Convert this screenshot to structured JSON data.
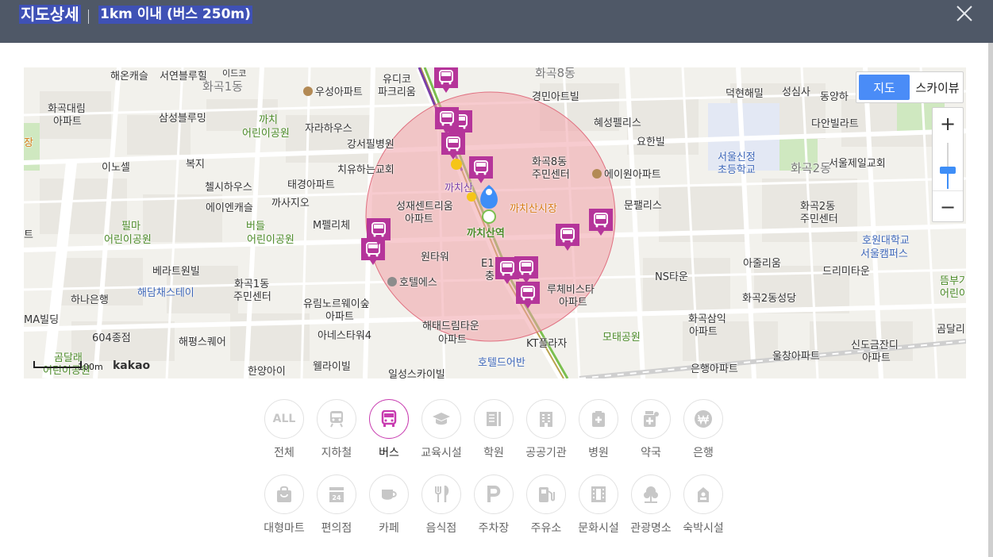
{
  "header": {
    "title": "지도상세",
    "subtitle": "1km 이내 (버스 250m)"
  },
  "map": {
    "maptype": {
      "map": "지도",
      "skyview": "스카이뷰"
    },
    "zoom": {
      "in": "+",
      "out": "−"
    },
    "scale_label": "100m",
    "provider": "kakao",
    "labels": {
      "l1": "해온캐슬",
      "l2": "서연블루힐",
      "l3": "화곡1동",
      "l4": "유디코",
      "l5": "화곡8동",
      "l6": "화곡대림",
      "l7": "아파트",
      "l8": "우성아파트",
      "l9": "파크리움",
      "l10": "경민아트빌",
      "l11": "덕현해밀",
      "l12": "성심사",
      "l13": "동양하",
      "l14": "삼성블루밍",
      "l15": "까치",
      "l16": "어린이공원",
      "l17": "자라하우스",
      "l18": "혜성펠리스",
      "l19": "다안빌라트",
      "l20": "강서필병원",
      "l21": "요한빌",
      "l22": "서울신정",
      "l23": "초등학교",
      "l24": "이노셀",
      "l25": "복지",
      "l26": "치유하는교회",
      "l27": "화곡8동",
      "l28": "주민센터",
      "l29": "에이원아파트",
      "l30": "서울제일교회",
      "l31": "화곡2동",
      "l32": "첼시하우스",
      "l33": "태경아파트",
      "l34": "까치산",
      "l35": "에이엔캐슬",
      "l36": "까사지오",
      "l37": "성재센트리움",
      "l38": "아파트",
      "l39": "까치산시장",
      "l40": "문팰리스",
      "l41": "화곡2동",
      "l42": "주민센터",
      "l43": "필마",
      "l44": "어린이공원",
      "l45": "버들",
      "l46": "어린이공원",
      "l47": "M펠리체",
      "l48": "까치산역",
      "l49": "호원대학교",
      "l50": "서울캠퍼스",
      "l51": "원타워",
      "l52": "E1",
      "l53": "아줄리움",
      "l54": "베라트원빌",
      "l55": "NS타운",
      "l56": "드리미타운",
      "l57": "화곡1동",
      "l58": "주민센터",
      "l59": "호텔에스",
      "l60": "충",
      "l61": "루체비스타",
      "l62": "아파트",
      "l63": "뜸부기",
      "l64": "어린이",
      "l65": "해담채스테이",
      "l66": "하나은행",
      "l67": "유림노르웨이숲",
      "l68": "아파트",
      "l69": "화곡2동성당",
      "l70": "MA빌딩",
      "l71": "해태드림타운",
      "l72": "아파트",
      "l73": "화곡삼익",
      "l74": "아파트",
      "l75": "곰달리",
      "l76": "604종점",
      "l77": "해평스퀘어",
      "l78": "아네스타워4",
      "l79": "모태공원",
      "l80": "KT플라자",
      "l81": "신도금잔디",
      "l82": "아파트",
      "l83": "울창아파트",
      "l84": "곰달래",
      "l85": "어린이공원",
      "l86": "한양아이",
      "l87": "웰라이빌",
      "l88": "호텔드어반",
      "l89": "일성스카이빌",
      "l90": "은행아파트",
      "l91": "장",
      "l92": "트",
      "l93": "이드코"
    }
  },
  "categories": [
    {
      "label": "전체",
      "icon": "all-icon"
    },
    {
      "label": "지하철",
      "icon": "subway-icon"
    },
    {
      "label": "버스",
      "icon": "bus-icon"
    },
    {
      "label": "교육시설",
      "icon": "graduation-cap-icon"
    },
    {
      "label": "학원",
      "icon": "book-icon"
    },
    {
      "label": "공공기관",
      "icon": "building-icon"
    },
    {
      "label": "병원",
      "icon": "hospital-icon"
    },
    {
      "label": "약국",
      "icon": "pharmacy-icon"
    },
    {
      "label": "은행",
      "icon": "won-icon"
    },
    {
      "label": "대형마트",
      "icon": "shopping-bag-icon"
    },
    {
      "label": "편의점",
      "icon": "convenience-store-icon"
    },
    {
      "label": "카페",
      "icon": "coffee-cup-icon"
    },
    {
      "label": "음식점",
      "icon": "fork-knife-icon"
    },
    {
      "label": "주차장",
      "icon": "parking-icon"
    },
    {
      "label": "주유소",
      "icon": "fuel-pump-icon"
    },
    {
      "label": "문화시설",
      "icon": "film-icon"
    },
    {
      "label": "관광명소",
      "icon": "tree-icon"
    },
    {
      "label": "숙박시설",
      "icon": "bed-icon"
    }
  ],
  "active_category": "버스",
  "colors": {
    "header_bg": "#4f5867",
    "accent": "#c83cb0",
    "radius_fill": "#f0a0a8",
    "maptype_active": "#4a8cf7"
  },
  "all_text": "ALL"
}
